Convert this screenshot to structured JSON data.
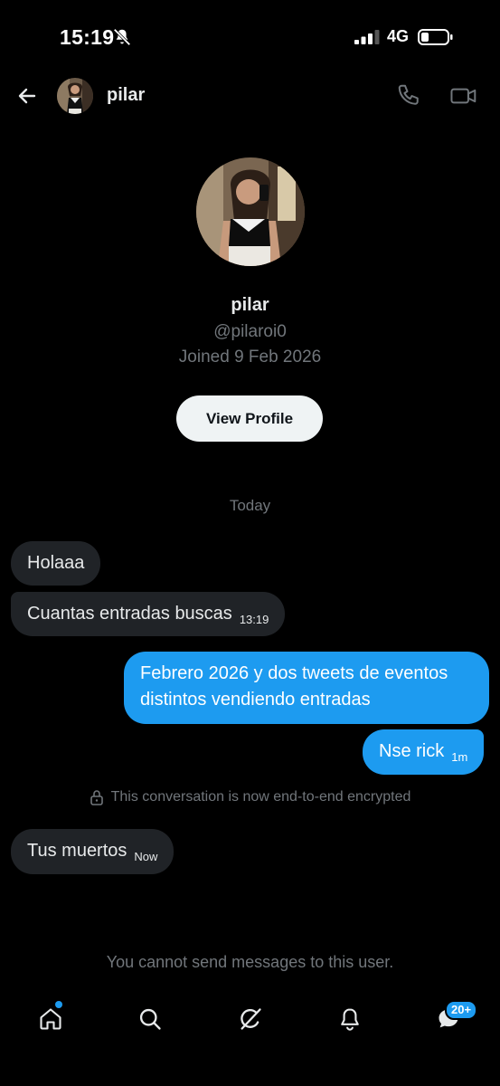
{
  "status_bar": {
    "time": "15:19",
    "network": "4G"
  },
  "header": {
    "name": "pilar"
  },
  "profile": {
    "name": "pilar",
    "handle": "@pilaroi0",
    "joined": "Joined 9 Feb 2026",
    "view_profile_label": "View Profile"
  },
  "date_divider": "Today",
  "messages": [
    {
      "direction": "incoming",
      "text": "Holaaa",
      "time": ""
    },
    {
      "direction": "incoming",
      "text": "Cuantas entradas buscas",
      "time": "13:19"
    },
    {
      "direction": "outgoing",
      "text": "Febrero 2026 y dos tweets de eventos distintos vendiendo entradas",
      "time": ""
    },
    {
      "direction": "outgoing",
      "text": "Nse rick",
      "time": "1m"
    },
    {
      "direction": "incoming",
      "text": "Tus muertos",
      "time": "Now"
    }
  ],
  "encryption_notice": "This conversation is now end-to-end encrypted",
  "cannot_send": "You cannot send messages to this user.",
  "tab_bar": {
    "messages_badge": "20+"
  },
  "colors": {
    "accent": "#1d9bf0",
    "incoming_bubble": "#202327",
    "muted_text": "#71767b"
  }
}
